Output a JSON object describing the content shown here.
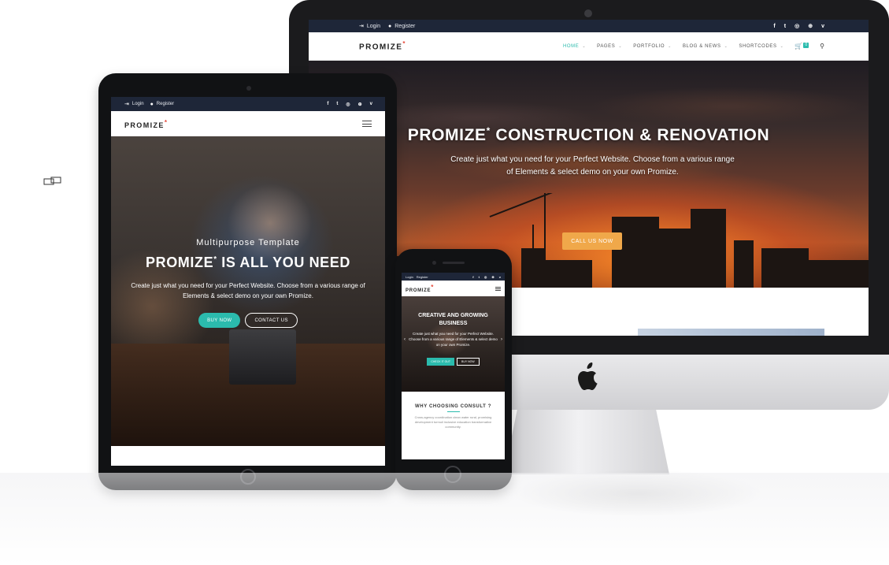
{
  "desktop": {
    "topbar": {
      "login": "Login",
      "register": "Register",
      "social_icons": [
        "facebook-icon",
        "twitter-icon",
        "instagram-icon",
        "dribbble-icon",
        "vimeo-icon"
      ]
    },
    "nav": {
      "brand": "PROMIZE",
      "brand_mark": "*",
      "menu": [
        {
          "label": "HOME",
          "active": true
        },
        {
          "label": "PAGES",
          "active": false
        },
        {
          "label": "PORTFOLIO",
          "active": false
        },
        {
          "label": "BLOG & NEWS",
          "active": false
        },
        {
          "label": "SHORTCODES",
          "active": false
        }
      ],
      "cart_count": "0"
    },
    "hero": {
      "title_a": "PROMIZE",
      "title_mark": "*",
      "title_b": " CONSTRUCTION & RENOVATION",
      "subtitle": "Create just what you need for your Perfect Website. Choose from a various range of Elements & select demo on your own Promize.",
      "button": "CALL US NOW"
    }
  },
  "tablet": {
    "topbar": {
      "login": "Login",
      "register": "Register"
    },
    "nav": {
      "brand": "PROMIZE",
      "brand_mark": "*"
    },
    "hero": {
      "kicker": "Multipurpose Template",
      "title_a": "PROMIZE",
      "title_mark": "*",
      "title_b": " IS ALL YOU NEED",
      "text": "Create just what you need for your Perfect Website. Choose from a various range of Elements & select demo on your own Promize.",
      "primary_button": "BUY NOW",
      "secondary_button": "CONTACT US"
    }
  },
  "phone": {
    "topbar": {
      "login": "Login",
      "register": "Register"
    },
    "nav": {
      "brand": "PROMIZE",
      "brand_mark": "*"
    },
    "hero": {
      "title": "CREATIVE AND GROWING BUSINESS",
      "text": "Create just what you need for your Perfect Website. Choose from a various range of Elements & select demo on your own Promize.",
      "primary_button": "CHECK IT OUT",
      "secondary_button": "BUY NOW"
    },
    "why": {
      "title": "WHY CHOOSING CONSULT ?",
      "text": "Cross-agency coordination clean water rural, promising development turmoil inclusive education transformative community."
    }
  },
  "colors": {
    "accent": "#2bbbad",
    "cta_orange": "#f0a84a",
    "topbar": "#1e2638",
    "brand_mark": "#e64a3b"
  }
}
